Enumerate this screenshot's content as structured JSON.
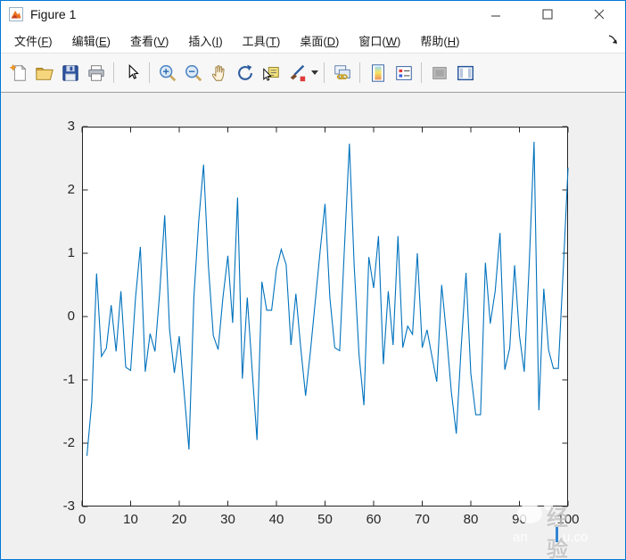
{
  "window": {
    "title": "Figure 1"
  },
  "menubar": {
    "items": [
      {
        "name": "file",
        "label": "文件",
        "key": "F"
      },
      {
        "name": "edit",
        "label": "编辑",
        "key": "E"
      },
      {
        "name": "view",
        "label": "查看",
        "key": "V"
      },
      {
        "name": "insert",
        "label": "插入",
        "key": "I"
      },
      {
        "name": "tools",
        "label": "工具",
        "key": "T"
      },
      {
        "name": "desktop",
        "label": "桌面",
        "key": "D"
      },
      {
        "name": "window",
        "label": "窗口",
        "key": "W"
      },
      {
        "name": "help",
        "label": "帮助",
        "key": "H"
      }
    ]
  },
  "toolbar": {
    "items": [
      "new-figure",
      "open-file",
      "save-figure",
      "print-figure",
      "|",
      "pointer",
      "|",
      "zoom-in",
      "zoom-out",
      "pan",
      "rotate-3d",
      "data-cursor",
      "brush",
      "brush-caret",
      "|",
      "link-plot",
      "|",
      "insert-colorbar",
      "insert-legend",
      "|",
      "hide-plot-tools",
      "show-plot-tools"
    ]
  },
  "chart_data": {
    "type": "line",
    "title": "",
    "xlabel": "",
    "ylabel": "",
    "xlim": [
      0,
      100
    ],
    "ylim": [
      -3,
      3
    ],
    "x_ticks": [
      0,
      10,
      20,
      30,
      40,
      50,
      60,
      70,
      80,
      90,
      100
    ],
    "y_ticks": [
      3,
      2,
      1,
      0,
      -1,
      -2,
      -3
    ],
    "grid": false,
    "legend_position": "none",
    "line_color": "#0072BD",
    "axis_color": "#262626",
    "plot_bg": "#ffffff",
    "figure_bg": "#f0f0f0",
    "x_start": 1,
    "values": [
      -2.2,
      -1.35,
      0.68,
      -0.63,
      -0.5,
      0.18,
      -0.55,
      0.4,
      -0.8,
      -0.85,
      0.3,
      1.1,
      -0.87,
      -0.27,
      -0.55,
      0.4,
      1.6,
      -0.2,
      -0.89,
      -0.31,
      -1.2,
      -2.1,
      0.3,
      1.5,
      2.4,
      0.8,
      -0.3,
      -0.52,
      0.3,
      0.96,
      -0.1,
      1.88,
      -0.98,
      0.3,
      -0.85,
      -1.95,
      0.55,
      0.1,
      0.1,
      0.75,
      1.06,
      0.82,
      -0.45,
      0.36,
      -0.5,
      -1.25,
      -0.55,
      0.25,
      1.05,
      1.78,
      0.3,
      -0.49,
      -0.54,
      1.1,
      2.73,
      0.8,
      -0.6,
      -1.4,
      0.94,
      0.45,
      1.27,
      -0.75,
      0.4,
      -0.45,
      1.27,
      -0.49,
      -0.15,
      -0.28,
      1.0,
      -0.49,
      -0.21,
      -0.63,
      -1.03,
      0.5,
      -0.3,
      -1.2,
      -1.85,
      -0.5,
      0.69,
      -0.9,
      -1.55,
      -1.55,
      0.85,
      -0.11,
      0.4,
      1.32,
      -0.84,
      -0.5,
      0.81,
      -0.3,
      -0.87,
      0.8,
      2.76,
      -1.48,
      0.44,
      -0.53,
      -0.82,
      -0.82,
      0.7,
      2.35
    ]
  },
  "watermark": {
    "text": "经验",
    "fragment_left": "an",
    "fragment_right": "u.co"
  },
  "colors": {
    "accent": "#0078d7"
  }
}
